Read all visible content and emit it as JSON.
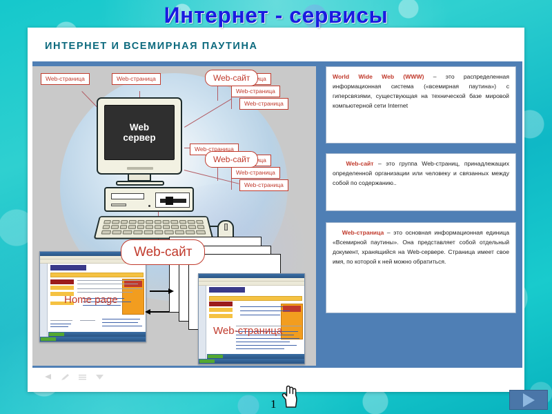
{
  "slide": {
    "title": "Интернет - сервисы",
    "subtitle": "ИНТЕРНЕТ И  ВСЕМИРНАЯ  ПАУТИНА",
    "slide_number": "1"
  },
  "colors": {
    "title": "#1a1ae0",
    "subtitle": "#0d6a7e",
    "accent_red": "#c0392b",
    "panel_blue": "#4f7fb5",
    "background_teal": "#11c4c8",
    "diagram_bg": "#c9c9c9"
  },
  "diagram": {
    "server_label_line1": "Web",
    "server_label_line2": "сервер",
    "labels": {
      "page_top_left": "Web-страница",
      "page_top_mid": "Web-страница",
      "site_top": "Web-сайт",
      "site_top_stack": [
        "Web-страница",
        "Web-страница",
        "Web-страница"
      ],
      "page_mid_right": "Web-страница",
      "site_bottom": "Web-сайт",
      "site_bottom_stack": [
        "Web-страница",
        "Web-страница",
        "Web-страница"
      ],
      "site_main": "Web-сайт"
    },
    "browser_left_caption": "Home page",
    "browser_right_caption": "Web-страница"
  },
  "panels": [
    {
      "id": "www",
      "key": "World Wide Web (WWW)",
      "text": " – это распределенная информационная система («всемирная паутина») с гиперсвязями, существующая на технической базе мировой компьютерной сети Internet"
    },
    {
      "id": "website",
      "key": "Web-сайт",
      "text": " – это группа Web-страниц, принадлежащих определенной организации или человеку и связанных между собой по содержанию.."
    },
    {
      "id": "webpage",
      "key": "Web-страница",
      "text": " – это основная информационная единица «Всемирной паутины». Она представляет собой отдельный документ, хранящийся на Web-сервере. Страница имеет свое имя, по которой к ней можно обратиться."
    }
  ],
  "footer": {
    "icons": [
      "undo-icon",
      "pen-icon",
      "menu-icon",
      "pointer-icon"
    ],
    "next_button": "next-slide-button",
    "cursor": "hand-cursor"
  }
}
